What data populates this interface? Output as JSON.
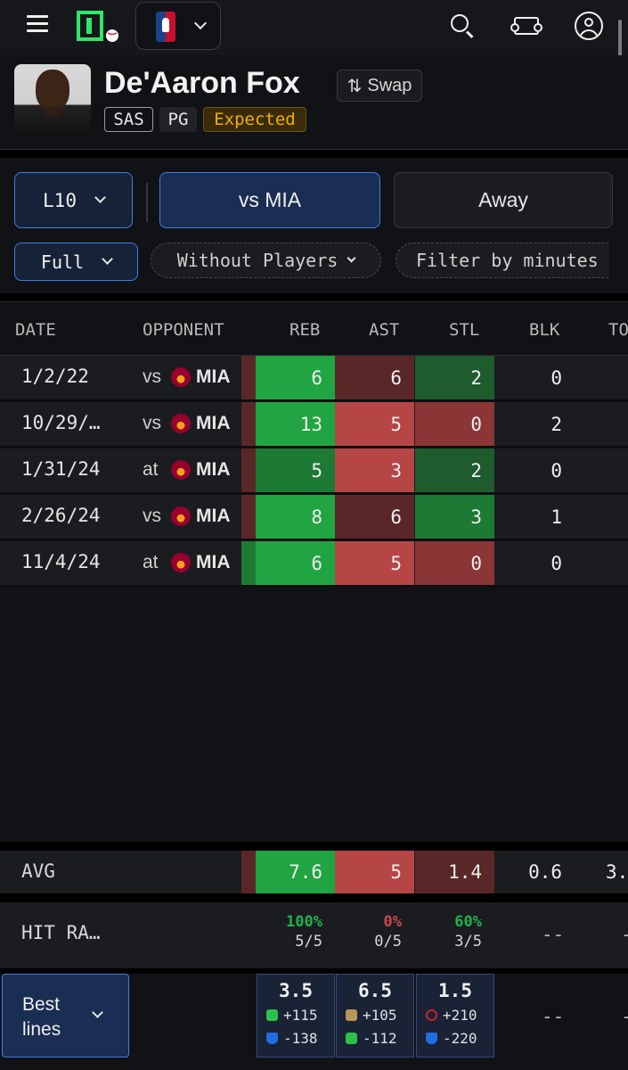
{
  "colors": {
    "green_strong": "#21a442",
    "green_mid": "#1c7a34",
    "green_dark": "#1e5c2d",
    "red_strong": "#b64646",
    "red_dark": "#5a2728",
    "red_mid": "#8a3536",
    "accent_blue": "#3e7ee6",
    "expected_gold": "#f0b000"
  },
  "topbar": {
    "menu_icon": "hamburger-icon",
    "logo_icon": "app-logo-icon",
    "sport_icon": "nba-logo-icon",
    "icons": [
      "search-icon",
      "ticket-icon",
      "user-icon"
    ]
  },
  "player": {
    "name": "De'Aaron Fox",
    "swap_label": "Swap",
    "team": "SAS",
    "position": "PG",
    "status": "Expected"
  },
  "filters": {
    "range": "L10",
    "opponent": "vs MIA",
    "location": "Away",
    "period": "Full",
    "without_players": "Without Players",
    "minutes": "Filter by minutes"
  },
  "table": {
    "headers": {
      "date": "DATE",
      "opponent": "OPPONENT",
      "reb": "REB",
      "ast": "AST",
      "stl": "STL",
      "blk": "BLK",
      "to": "TO"
    },
    "rows": [
      {
        "date": "1/2/22",
        "ha": "vs",
        "team": "MIA",
        "reb": "6",
        "ast": "6",
        "stl": "2",
        "blk": "0"
      },
      {
        "date": "10/29/…",
        "ha": "vs",
        "team": "MIA",
        "reb": "13",
        "ast": "5",
        "stl": "0",
        "blk": "2"
      },
      {
        "date": "1/31/24",
        "ha": "at",
        "team": "MIA",
        "reb": "5",
        "ast": "3",
        "stl": "2",
        "blk": "0"
      },
      {
        "date": "2/26/24",
        "ha": "vs",
        "team": "MIA",
        "reb": "8",
        "ast": "6",
        "stl": "3",
        "blk": "1"
      },
      {
        "date": "11/4/24",
        "ha": "at",
        "team": "MIA",
        "reb": "6",
        "ast": "5",
        "stl": "0",
        "blk": "0"
      }
    ]
  },
  "avg": {
    "label": "AVG",
    "reb": "7.6",
    "ast": "5",
    "stl": "1.4",
    "blk": "0.6",
    "to": "3."
  },
  "hit_rate": {
    "label": "HIT RA…",
    "reb_pct": "100%",
    "reb_frac": "5/5",
    "ast_pct": "0%",
    "ast_frac": "0/5",
    "stl_pct": "60%",
    "stl_frac": "3/5",
    "blk": "--",
    "to": "-"
  },
  "best_lines": {
    "label": "Best lines",
    "reb": {
      "line": "3.5",
      "over": "+115",
      "under": "-138"
    },
    "ast": {
      "line": "6.5",
      "over": "+105",
      "under": "-112"
    },
    "stl": {
      "line": "1.5",
      "over": "+210",
      "under": "-220"
    },
    "blk": "--",
    "to": "-"
  }
}
